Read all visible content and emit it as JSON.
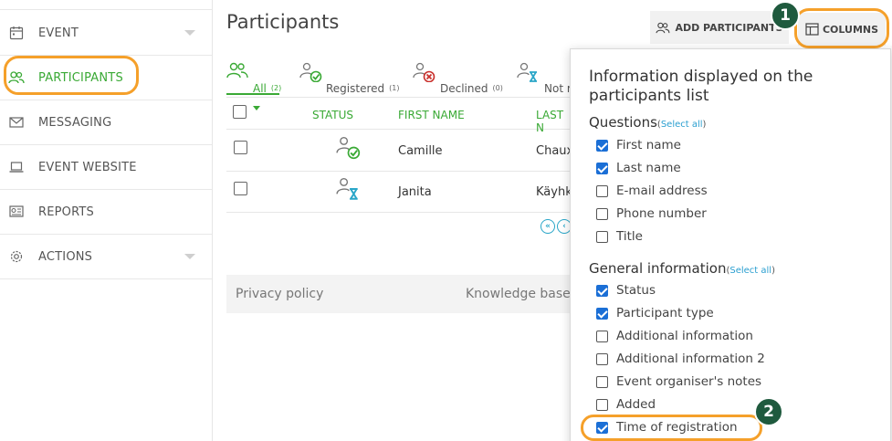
{
  "sidebar": {
    "items": [
      {
        "label": "EVENT",
        "icon": "calendar-icon",
        "has_caret": true
      },
      {
        "label": "PARTICIPANTS",
        "icon": "people-icon",
        "active": true
      },
      {
        "label": "MESSAGING",
        "icon": "envelope-icon"
      },
      {
        "label": "EVENT WEBSITE",
        "icon": "laptop-icon"
      },
      {
        "label": "REPORTS",
        "icon": "report-icon"
      },
      {
        "label": "ACTIONS",
        "icon": "gear-icon",
        "has_caret": true
      }
    ]
  },
  "header": {
    "title": "Participants",
    "add_participants_label": "ADD PARTICIPANTS",
    "columns_label": "COLUMNS",
    "badge_1": "1",
    "badge_2": "2"
  },
  "tabs": [
    {
      "label": "All",
      "count": "(2)",
      "icon": "people-icon",
      "active": true
    },
    {
      "label": "Registered",
      "count": "(1)",
      "icon": "person-check-icon"
    },
    {
      "label": "Declined",
      "count": "(0)",
      "icon": "person-declined-icon"
    },
    {
      "label": "Not r",
      "count": "",
      "icon": "person-hourglass-icon"
    }
  ],
  "table": {
    "columns": [
      "STATUS",
      "FIRST NAME",
      "LAST N"
    ],
    "rows": [
      {
        "first_name": "Camille",
        "last_name": "Chaux",
        "status_icon": "person-check-icon"
      },
      {
        "first_name": "Janita",
        "last_name": "Käyhk",
        "status_icon": "person-hourglass-icon"
      }
    ],
    "pager": [
      "«",
      "‹"
    ]
  },
  "footer": {
    "privacy": "Privacy policy",
    "knowledge": "Knowledge base"
  },
  "columns_panel": {
    "title": "Information displayed on the participants list",
    "sections": [
      {
        "title": "Questions",
        "select_all": "Select all",
        "options": [
          {
            "label": "First name",
            "checked": true
          },
          {
            "label": "Last name",
            "checked": true
          },
          {
            "label": "E-mail address",
            "checked": false
          },
          {
            "label": "Phone number",
            "checked": false
          },
          {
            "label": "Title",
            "checked": false
          }
        ]
      },
      {
        "title": "General information",
        "select_all": "Select all",
        "options": [
          {
            "label": "Status",
            "checked": true
          },
          {
            "label": "Participant type",
            "checked": true
          },
          {
            "label": "Additional information",
            "checked": false
          },
          {
            "label": "Additional information 2",
            "checked": false
          },
          {
            "label": "Event organiser's notes",
            "checked": false
          },
          {
            "label": "Added",
            "checked": false
          },
          {
            "label": "Time of registration",
            "checked": true
          }
        ]
      }
    ]
  },
  "colors": {
    "accent_green": "#3aa935",
    "highlight_orange": "#f5a02a",
    "badge_green": "#1f5a3e",
    "checkbox_blue": "#1b6fd6",
    "link_blue": "#2b9fd0"
  }
}
